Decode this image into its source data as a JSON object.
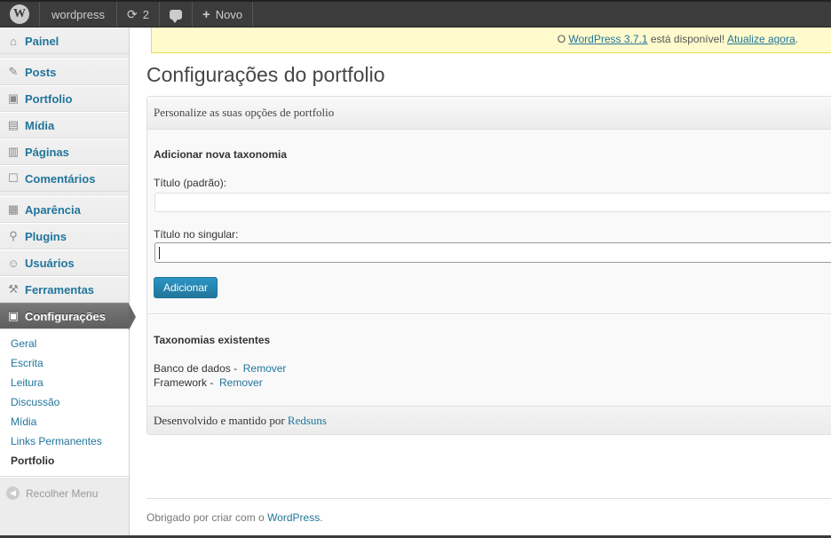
{
  "adminbar": {
    "site_name": "wordpress",
    "updates_count": "2",
    "new_label": "Novo"
  },
  "sidebar": {
    "items": [
      {
        "label": "Painel",
        "icon": "dashboard-icon"
      },
      {
        "label": "Posts",
        "icon": "pin-icon"
      },
      {
        "label": "Portfolio",
        "icon": "briefcase-icon"
      },
      {
        "label": "Mídia",
        "icon": "media-icon"
      },
      {
        "label": "Páginas",
        "icon": "pages-icon"
      },
      {
        "label": "Comentários",
        "icon": "comments-icon"
      },
      {
        "label": "Aparência",
        "icon": "appearance-icon"
      },
      {
        "label": "Plugins",
        "icon": "plugins-icon"
      },
      {
        "label": "Usuários",
        "icon": "users-icon"
      },
      {
        "label": "Ferramentas",
        "icon": "tools-icon"
      },
      {
        "label": "Configurações",
        "icon": "settings-icon"
      }
    ],
    "submenu": [
      "Geral",
      "Escrita",
      "Leitura",
      "Discussão",
      "Mídia",
      "Links Permanentes",
      "Portfolio"
    ],
    "collapse_label": "Recolher Menu"
  },
  "notice": {
    "prefix": "O ",
    "version_link": "WordPress 3.7.1",
    "middle": " está disponível! ",
    "update_link": "Atualize agora",
    "suffix": "."
  },
  "page": {
    "title": "Configurações do portfolio",
    "panel_header": "Personalize as suas opções de portfolio",
    "add_section_title": "Adicionar nova taxonomia",
    "field1_label": "Título (padrão):",
    "field1_value": "",
    "field2_label": "Título no singular:",
    "field2_value": "",
    "add_button": "Adicionar",
    "existing_title": "Taxonomias existentes",
    "taxonomies": [
      {
        "name": "Banco de dados",
        "action": "Remover"
      },
      {
        "name": "Framework",
        "action": "Remover"
      }
    ],
    "footer_text": "Desenvolvido e mantido por ",
    "footer_link": "Redsuns"
  },
  "footer": {
    "text": "Obrigado por criar com o ",
    "link": "WordPress",
    "suffix": "."
  },
  "colors": {
    "link": "#21759b",
    "adminbar": "#3c3c3c",
    "notice_bg": "#fffbcc",
    "current_menu": "#6d6d6d"
  }
}
